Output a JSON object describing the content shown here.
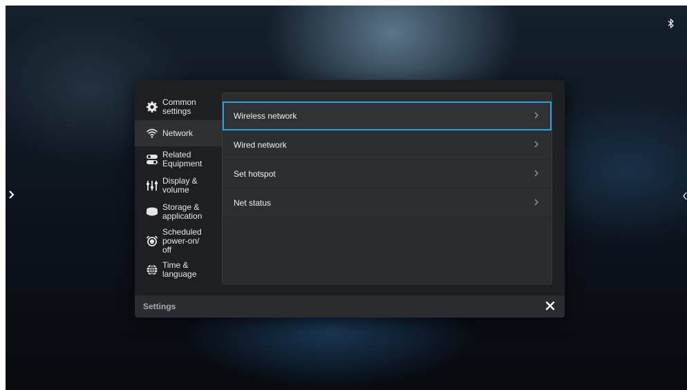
{
  "status_bar": {
    "bluetooth_icon": "bluetooth-icon"
  },
  "sidebar": {
    "items": [
      {
        "label": "Common settings",
        "icon": "gear-icon"
      },
      {
        "label": "Network",
        "icon": "wifi-icon",
        "active": true
      },
      {
        "label": "Related Equipment",
        "icon": "toggle-icon"
      },
      {
        "label": "Display & volume",
        "icon": "sliders-icon"
      },
      {
        "label": "Storage & application",
        "icon": "storage-icon"
      },
      {
        "label": "Scheduled power-on/ off",
        "icon": "alarm-clock-icon"
      },
      {
        "label": "Time & language",
        "icon": "globe-icon"
      }
    ]
  },
  "network_menu": {
    "items": [
      {
        "label": "Wireless network",
        "focused": true
      },
      {
        "label": "Wired network"
      },
      {
        "label": "Set hotspot"
      },
      {
        "label": "Net status"
      }
    ]
  },
  "footer": {
    "title": "Settings",
    "close_icon": "close-icon"
  },
  "colors": {
    "focus": "#2aa4de",
    "dialog_bg": "#1d1f22",
    "panel_bg": "#2a2c30"
  }
}
